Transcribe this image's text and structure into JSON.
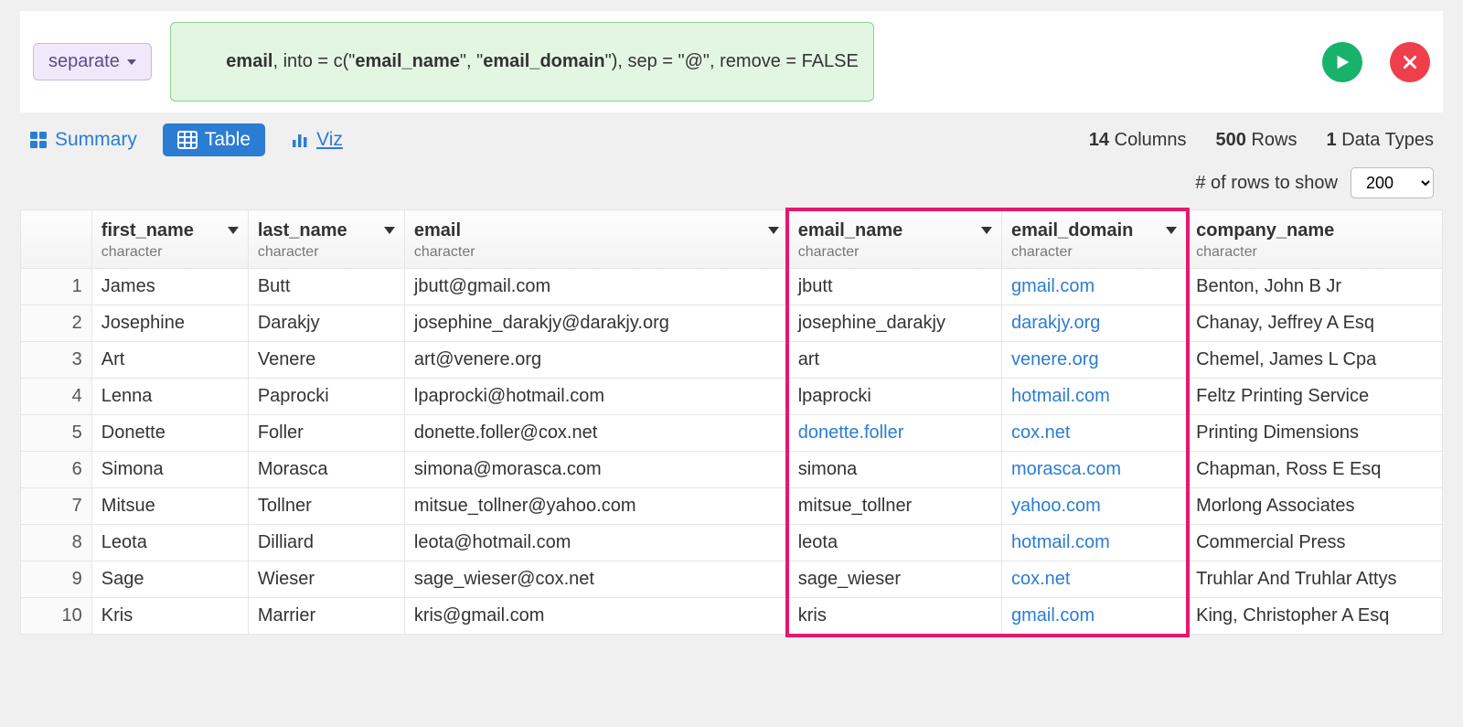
{
  "command": {
    "function_label": "separate",
    "code_prefix": "",
    "col": "email",
    "code_mid1": ", into = c(\"",
    "into1": "email_name",
    "code_mid2": "\", \"",
    "into2": "email_domain",
    "code_suffix": "\"), sep = \"@\", remove = FALSE"
  },
  "tabs": {
    "summary": "Summary",
    "table": "Table",
    "viz": "Viz"
  },
  "stats": {
    "columns_n": "14",
    "columns_label": "Columns",
    "rows_n": "500",
    "rows_label": "Rows",
    "types_n": "1",
    "types_label": "Data Types"
  },
  "rows_show": {
    "label": "# of rows to show",
    "value": "200"
  },
  "columns": [
    {
      "name": "first_name",
      "type": "character",
      "chevron": true,
      "highlighted": false,
      "width": "11%"
    },
    {
      "name": "last_name",
      "type": "character",
      "chevron": true,
      "highlighted": false,
      "width": "11%"
    },
    {
      "name": "email",
      "type": "character",
      "chevron": true,
      "highlighted": false,
      "width": "27%"
    },
    {
      "name": "email_name",
      "type": "character",
      "chevron": true,
      "highlighted": true,
      "width": "15%"
    },
    {
      "name": "email_domain",
      "type": "character",
      "chevron": true,
      "highlighted": true,
      "width": "13%"
    },
    {
      "name": "company_name",
      "type": "character",
      "chevron": false,
      "highlighted": false,
      "width": "18%"
    }
  ],
  "link_columns": [
    "email_domain"
  ],
  "link_cells": {
    "4": [
      "email_name"
    ]
  },
  "rows": [
    {
      "first_name": "James",
      "last_name": "Butt",
      "email": "jbutt@gmail.com",
      "email_name": "jbutt",
      "email_domain": "gmail.com",
      "company_name": "Benton, John B Jr"
    },
    {
      "first_name": "Josephine",
      "last_name": "Darakjy",
      "email": "josephine_darakjy@darakjy.org",
      "email_name": "josephine_darakjy",
      "email_domain": "darakjy.org",
      "company_name": "Chanay, Jeffrey A Esq"
    },
    {
      "first_name": "Art",
      "last_name": "Venere",
      "email": "art@venere.org",
      "email_name": "art",
      "email_domain": "venere.org",
      "company_name": "Chemel, James L Cpa"
    },
    {
      "first_name": "Lenna",
      "last_name": "Paprocki",
      "email": "lpaprocki@hotmail.com",
      "email_name": "lpaprocki",
      "email_domain": "hotmail.com",
      "company_name": "Feltz Printing Service"
    },
    {
      "first_name": "Donette",
      "last_name": "Foller",
      "email": "donette.foller@cox.net",
      "email_name": "donette.foller",
      "email_domain": "cox.net",
      "company_name": "Printing Dimensions"
    },
    {
      "first_name": "Simona",
      "last_name": "Morasca",
      "email": "simona@morasca.com",
      "email_name": "simona",
      "email_domain": "morasca.com",
      "company_name": "Chapman, Ross E Esq"
    },
    {
      "first_name": "Mitsue",
      "last_name": "Tollner",
      "email": "mitsue_tollner@yahoo.com",
      "email_name": "mitsue_tollner",
      "email_domain": "yahoo.com",
      "company_name": "Morlong Associates"
    },
    {
      "first_name": "Leota",
      "last_name": "Dilliard",
      "email": "leota@hotmail.com",
      "email_name": "leota",
      "email_domain": "hotmail.com",
      "company_name": "Commercial Press"
    },
    {
      "first_name": "Sage",
      "last_name": "Wieser",
      "email": "sage_wieser@cox.net",
      "email_name": "sage_wieser",
      "email_domain": "cox.net",
      "company_name": "Truhlar And Truhlar Attys"
    },
    {
      "first_name": "Kris",
      "last_name": "Marrier",
      "email": "kris@gmail.com",
      "email_name": "kris",
      "email_domain": "gmail.com",
      "company_name": "King, Christopher A Esq"
    }
  ]
}
